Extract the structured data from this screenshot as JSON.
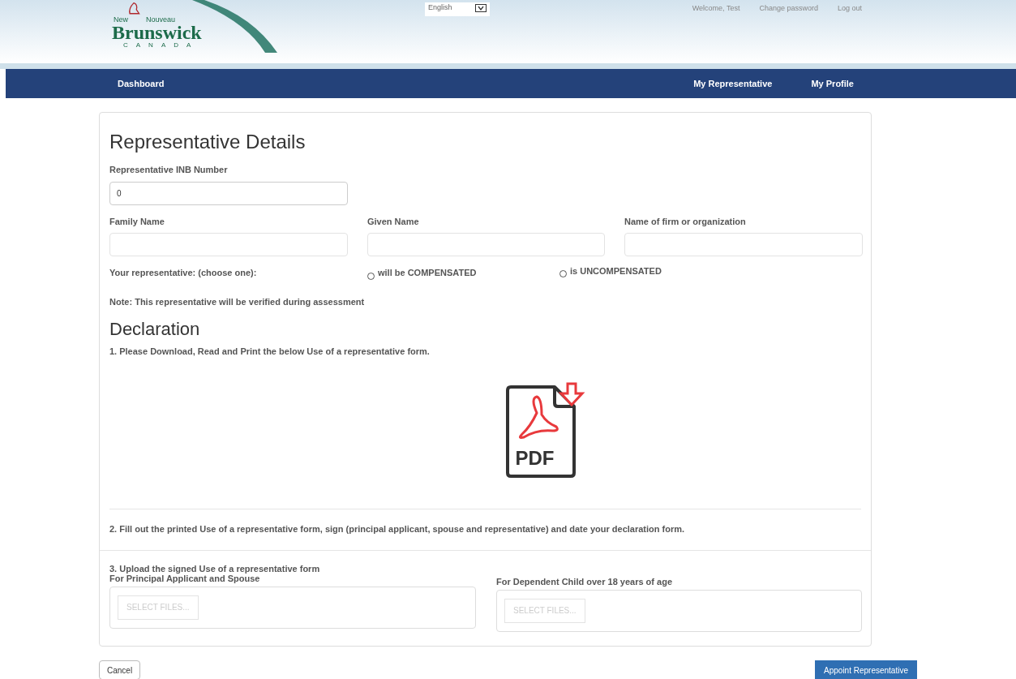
{
  "header": {
    "logo": {
      "small": "New",
      "small2": "Nouveau",
      "name": "Brunswick",
      "country": "CANADA"
    },
    "language": {
      "value": "English"
    },
    "links": [
      "Welcome, Test",
      "Change password",
      "Log out"
    ]
  },
  "nav": {
    "left": [
      {
        "label": "Dashboard"
      }
    ],
    "right": [
      {
        "label": "My Representative"
      },
      {
        "label": "My Profile"
      }
    ]
  },
  "form": {
    "title": "Representative Details",
    "inb": {
      "label": "Representative INB Number",
      "value": "0"
    },
    "names": [
      {
        "label": "Family Name"
      },
      {
        "label": "Given Name"
      },
      {
        "label": "Name of firm or organization"
      }
    ],
    "choice": {
      "label": "Your representative: (choose one):",
      "options": [
        {
          "label": "will be COMPENSATED",
          "selected": false
        },
        {
          "label": "is UNCOMPENSATED",
          "selected": false
        }
      ]
    },
    "note": "Note: This representative will be verified during assessment"
  },
  "declaration": {
    "title": "Declaration",
    "step1": "1. Please Download, Read and Print the below Use of a representative form.",
    "pdf_label": "PDF",
    "step2": "2. Fill out the printed Use of a representative form, sign (principal applicant, spouse and representative) and date your declaration form.",
    "step3": "3. Upload the signed Use of a representative form",
    "uploads": [
      {
        "label": "For Principal Applicant and Spouse",
        "button": "SELECT FILES..."
      },
      {
        "label": "For Dependent Child over 18 years of age",
        "button": "SELECT FILES..."
      }
    ]
  },
  "buttons": {
    "cancel": "Cancel",
    "submit": "Appoint Representative"
  }
}
